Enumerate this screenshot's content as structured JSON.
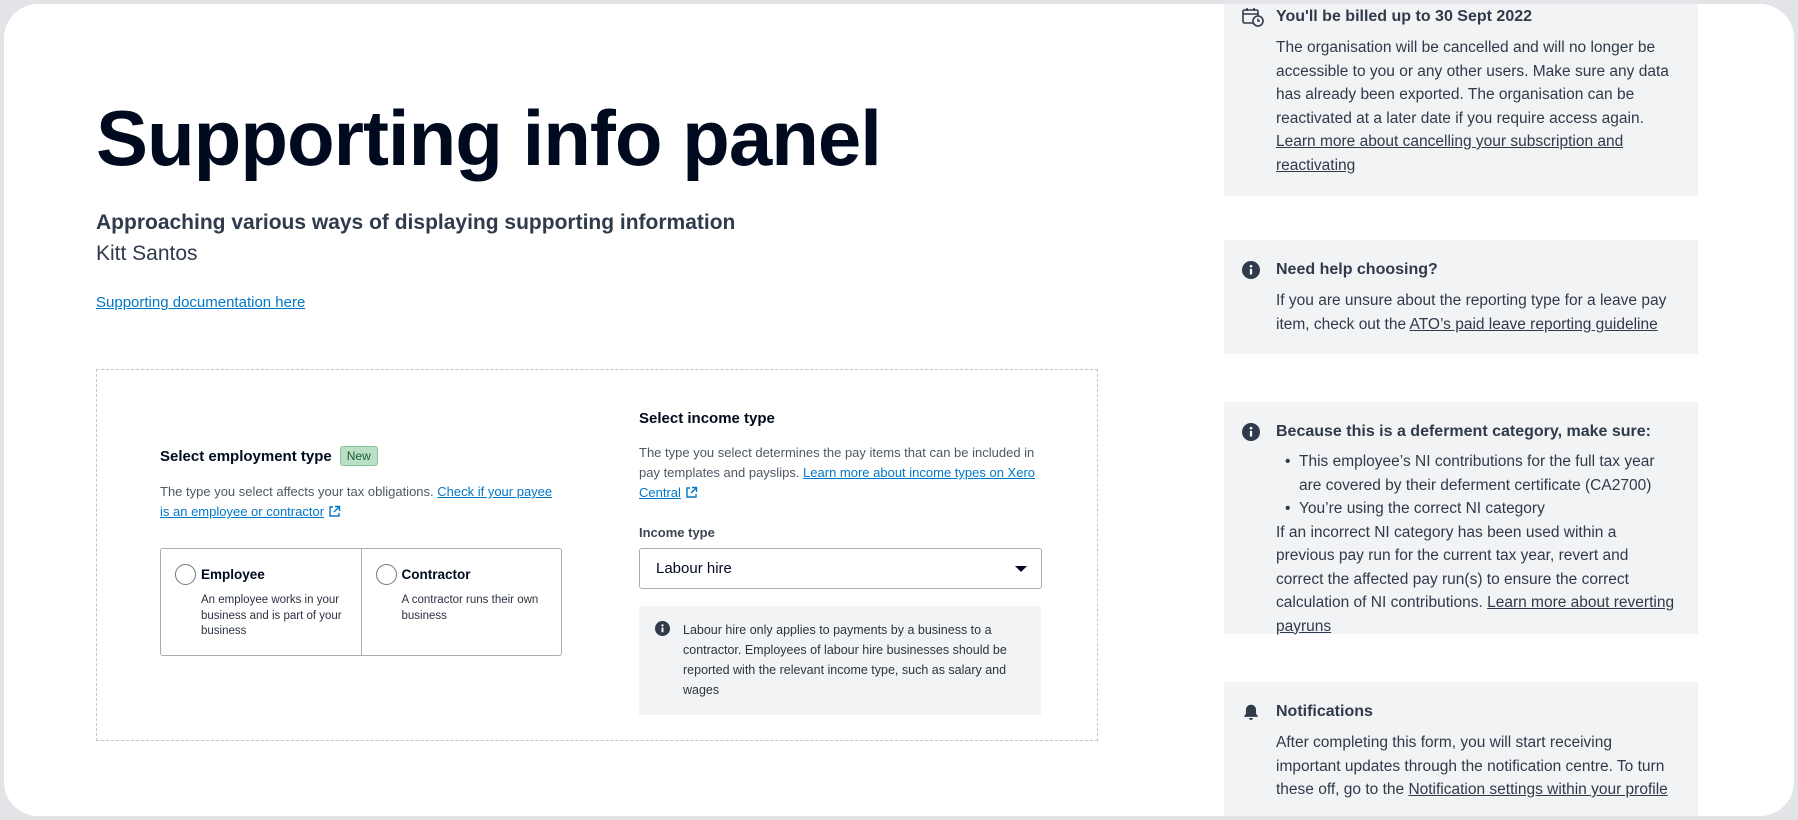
{
  "header": {
    "title": "Supporting info panel",
    "subtitle": "Approaching various ways of displaying supporting information",
    "author": "Kitt Santos",
    "doc_link": "Supporting documentation here"
  },
  "employment": {
    "heading": "Select employment type",
    "badge": "New",
    "help_text": "The type you select affects your tax obligations. ",
    "help_link": "Check if your payee is an employee or contractor",
    "options": [
      {
        "title": "Employee",
        "desc": "An employee works in your business and is part of your business"
      },
      {
        "title": "Contractor",
        "desc": "A contractor runs their own business"
      }
    ]
  },
  "income": {
    "heading": "Select income type",
    "help_text": "The type you select determines the pay items that can be included in pay templates and payslips. ",
    "help_link": "Learn more about income types on Xero Central",
    "field_label": "Income type",
    "selected": "Labour hire",
    "info": "Labour hire only applies to payments by a business to a contractor. Employees of labour hire businesses should be reported with the relevant income type, such as salary and wages"
  },
  "panels": [
    {
      "icon": "calendar-clock-icon",
      "title": "You'll be billed up to 30 Sept 2022",
      "body": "The organisation will be cancelled and will no longer be accessible to you or any other users. Make sure any data has already been exported. The organisation can be reactivated at a later date if you require access again.",
      "link": "Learn more about cancelling your subscription and reactivating"
    },
    {
      "icon": "info-icon",
      "title": "Need help choosing?",
      "body": "If you are unsure about the reporting type for a leave pay item, check out the ",
      "link": "ATO’s paid leave reporting guideline"
    },
    {
      "icon": "info-icon",
      "title": "Because this is a deferment category, make sure:",
      "items": [
        "This employee’s NI contributions for the full tax year are covered by their deferment certificate (CA2700)",
        "You’re using the correct NI category"
      ],
      "body": "If an incorrect NI category has been used within a previous pay run for the current tax year, revert and correct the affected pay run(s) to ensure the correct calculation of NI contributions. ",
      "link": "Learn more about reverting payruns"
    },
    {
      "icon": "bell-icon",
      "title": "Notifications",
      "body": "After completing this form, you will start receiving important updates through the notification centre. To turn these off, go to the ",
      "link": "Notification settings within your profile"
    }
  ],
  "colors": {
    "link": "#0078c8",
    "panel_bg": "#f2f3f4",
    "badge_bg": "#b9e0c4",
    "text": "#2f3a4a"
  }
}
